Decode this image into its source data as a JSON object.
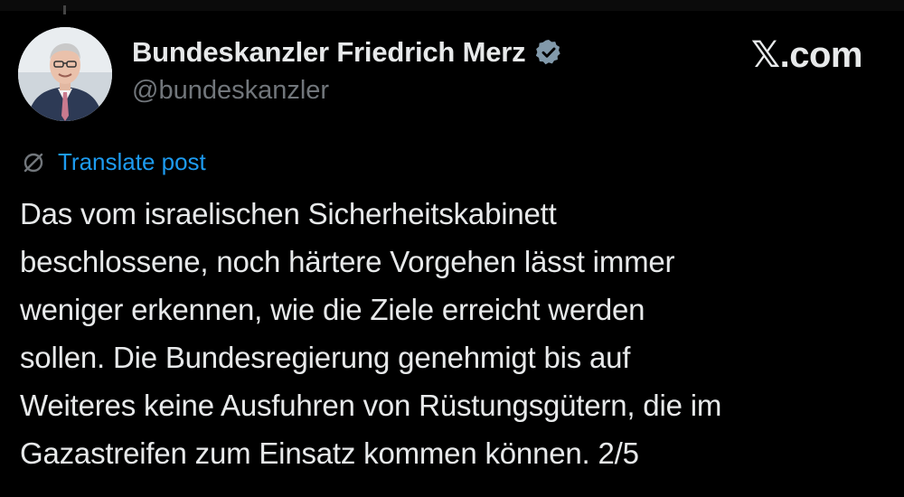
{
  "post": {
    "author": {
      "display_name": "Bundeskanzler Friedrich Merz",
      "handle": "@bundeskanzler",
      "verified_icon": "verified-badge-icon",
      "badge_color": "#829aab"
    },
    "brand": "𝕏.com",
    "translate": {
      "icon": "translate-globe-icon",
      "label": "Translate post",
      "color": "#1d9bf0"
    },
    "text_lines": [
      "Das vom israelischen Sicherheitskabinett",
      "beschlossene, noch härtere Vorgehen lässt immer",
      "weniger erkennen, wie die Ziele erreicht werden",
      "sollen. Die Bundesregierung genehmigt bis auf",
      "Weiteres keine Ausfuhren von Rüstungsgütern, die im",
      "Gazastreifen zum Einsatz kommen können. 2/5"
    ]
  }
}
